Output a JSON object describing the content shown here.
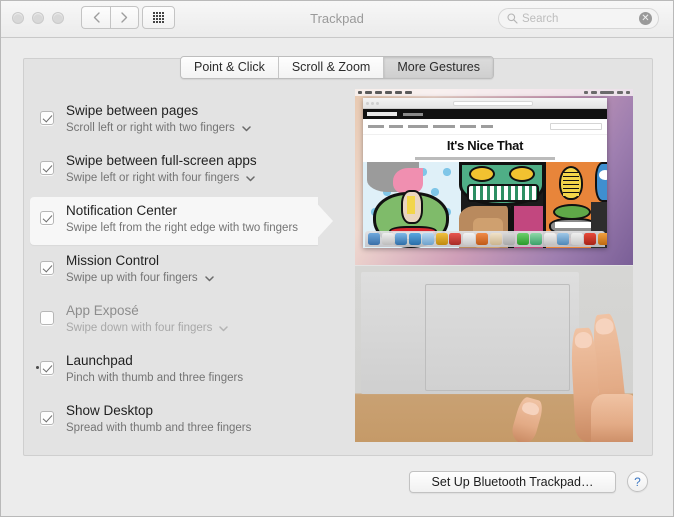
{
  "window": {
    "title": "Trackpad",
    "traffic_lights": [
      "close",
      "minimize",
      "zoom"
    ]
  },
  "toolbar": {
    "back_label": "‹",
    "forward_label": "›",
    "show_all_label": "show-all-grid"
  },
  "search": {
    "placeholder": "Search",
    "value": "",
    "clear_label": "✕",
    "icon": "search-icon"
  },
  "tabs": [
    {
      "label": "Point & Click",
      "active": false
    },
    {
      "label": "Scroll & Zoom",
      "active": false
    },
    {
      "label": "More Gestures",
      "active": true
    }
  ],
  "gestures": [
    {
      "title": "Swipe between pages",
      "description": "Scroll left or right with two fingers",
      "checked": true,
      "enabled": true,
      "has_dropdown": true,
      "selected": false
    },
    {
      "title": "Swipe between full-screen apps",
      "description": "Swipe left or right with four fingers",
      "checked": true,
      "enabled": true,
      "has_dropdown": true,
      "selected": false
    },
    {
      "title": "Notification Center",
      "description": "Swipe left from the right edge with two fingers",
      "checked": true,
      "enabled": true,
      "has_dropdown": false,
      "selected": true
    },
    {
      "title": "Mission Control",
      "description": "Swipe up with four fingers",
      "checked": true,
      "enabled": true,
      "has_dropdown": true,
      "selected": false
    },
    {
      "title": "App Exposé",
      "description": "Swipe down with four fingers",
      "checked": false,
      "enabled": false,
      "has_dropdown": true,
      "selected": false
    },
    {
      "title": "Launchpad",
      "description": "Pinch with thumb and three fingers",
      "checked": true,
      "enabled": true,
      "has_dropdown": false,
      "selected": false
    },
    {
      "title": "Show Desktop",
      "description": "Spread with thumb and three fingers",
      "checked": true,
      "enabled": true,
      "has_dropdown": false,
      "selected": false
    }
  ],
  "preview": {
    "screen_demo": {
      "site_title": "It's Nice That",
      "description": "screen recording of a website with colorful pop-art faces"
    },
    "hand_demo": {
      "description": "hand swiping two fingers from right edge of a trackpad"
    }
  },
  "footer": {
    "bluetooth_button": "Set Up Bluetooth Trackpad…",
    "help_button": "?"
  },
  "colors": {
    "window_bg": "#ececec",
    "panel_bg": "#e3e3e3",
    "selected_row": "#f7f7f7",
    "title_text": "#9a9a9a",
    "help_blue": "#3c77c2"
  }
}
